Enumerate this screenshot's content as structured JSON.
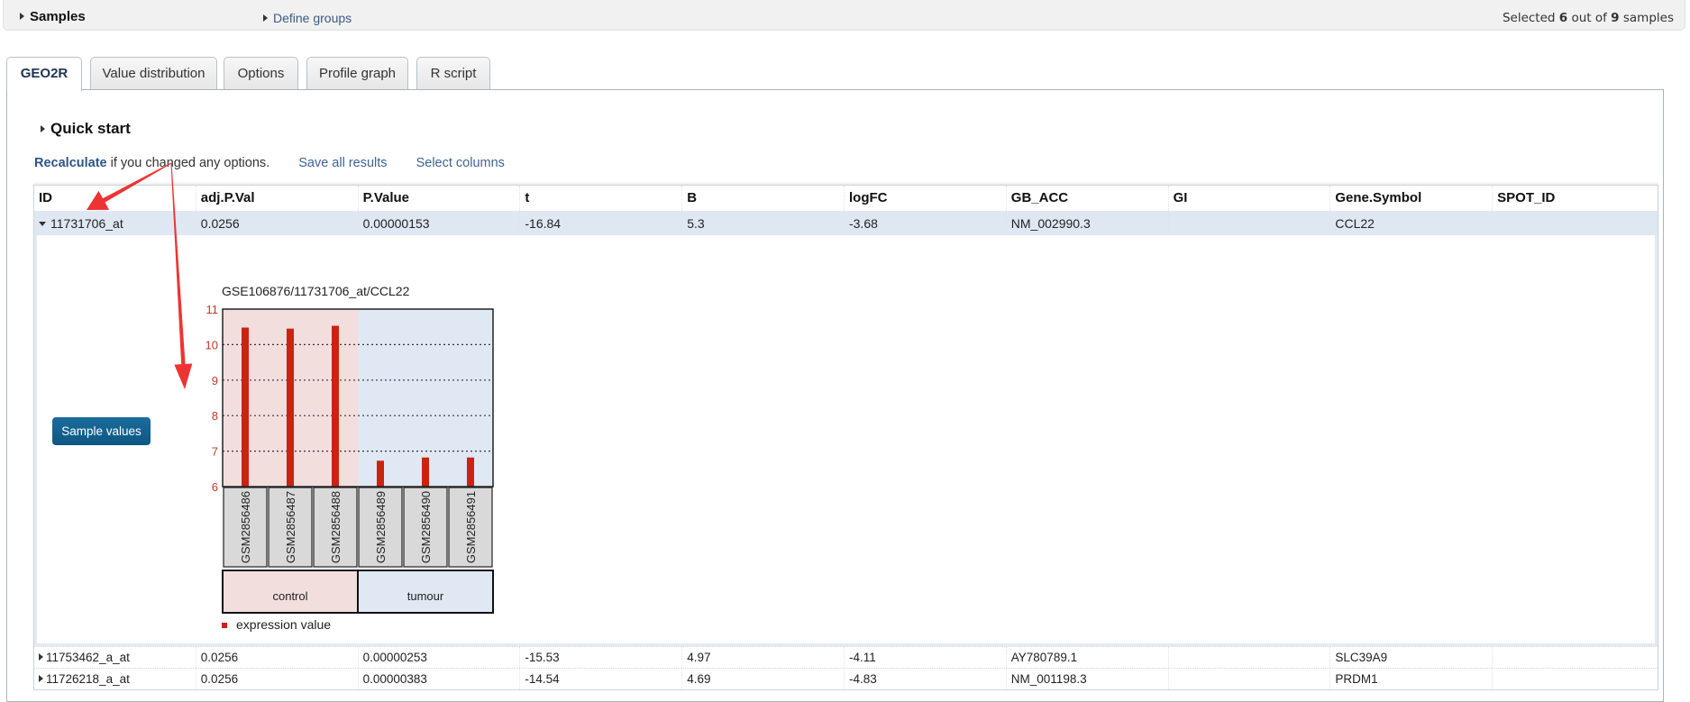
{
  "samples_bar": {
    "title": "Samples",
    "define_groups": "Define groups",
    "selected_prefix": "Selected ",
    "selected_count": "6",
    "selected_middle": " out of ",
    "total_count": "9",
    "selected_suffix": " samples"
  },
  "tabs": [
    {
      "label": "GEO2R",
      "active": true
    },
    {
      "label": "Value distribution",
      "active": false
    },
    {
      "label": "Options",
      "active": false
    },
    {
      "label": "Profile graph",
      "active": false
    },
    {
      "label": "R script",
      "active": false
    }
  ],
  "quick_start": "Quick start",
  "actions": {
    "recalculate": "Recalculate",
    "recalculate_note": " if you changed any options.",
    "save_all": "Save all results",
    "select_columns": "Select columns"
  },
  "table": {
    "columns": [
      "ID",
      "adj.P.Val",
      "P.Value",
      "t",
      "B",
      "logFC",
      "GB_ACC",
      "GI",
      "Gene.Symbol",
      "SPOT_ID"
    ],
    "rows": [
      {
        "expanded": true,
        "cells": [
          "11731706_at",
          "0.0256",
          "0.00000153",
          "-16.84",
          "5.3",
          "-3.68",
          "NM_002990.3",
          "",
          "CCL22",
          ""
        ]
      },
      {
        "expanded": false,
        "cells": [
          "11753462_a_at",
          "0.0256",
          "0.00000253",
          "-15.53",
          "4.97",
          "-4.11",
          "AY780789.1",
          "",
          "SLC39A9",
          ""
        ]
      },
      {
        "expanded": false,
        "cells": [
          "11726218_a_at",
          "0.0256",
          "0.00000383",
          "-14.54",
          "4.69",
          "-4.83",
          "NM_001198.3",
          "",
          "PRDM1",
          ""
        ]
      }
    ]
  },
  "detail": {
    "sample_values_button": "Sample values"
  },
  "chart_data": {
    "type": "bar",
    "title": "GSE106876/11731706_at/CCL22",
    "categories": [
      "GSM2856486",
      "GSM2856487",
      "GSM2856488",
      "GSM2856489",
      "GSM2856490",
      "GSM2856491"
    ],
    "values": [
      10.48,
      10.45,
      10.53,
      6.73,
      6.82,
      6.82
    ],
    "groups": [
      {
        "name": "control",
        "samples": [
          "GSM2856486",
          "GSM2856487",
          "GSM2856488"
        ],
        "color": "#f3dede"
      },
      {
        "name": "tumour",
        "samples": [
          "GSM2856489",
          "GSM2856490",
          "GSM2856491"
        ],
        "color": "#dfe8f3"
      }
    ],
    "ylim": [
      6,
      11
    ],
    "yticks": [
      6,
      7,
      8,
      9,
      10,
      11
    ],
    "grid": true,
    "bar_color": "#cc2211",
    "tick_color": "#c0392b",
    "legend": [
      {
        "label": "expression value",
        "color": "#cc2211"
      }
    ],
    "legend_position": "bottom-left",
    "xlabel": "",
    "ylabel": ""
  },
  "annotation_color": "#ee3333"
}
